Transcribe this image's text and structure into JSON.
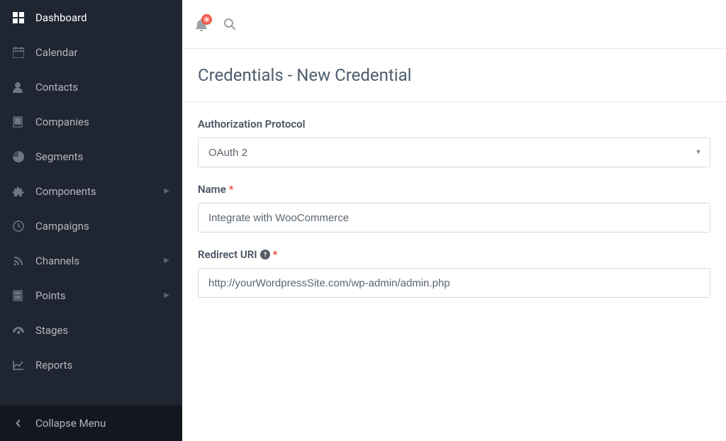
{
  "sidebar": {
    "items": [
      {
        "label": "Dashboard",
        "icon": "grid-icon",
        "caret": false
      },
      {
        "label": "Calendar",
        "icon": "calendar-icon",
        "caret": false
      },
      {
        "label": "Contacts",
        "icon": "user-icon",
        "caret": false
      },
      {
        "label": "Companies",
        "icon": "building-icon",
        "caret": false
      },
      {
        "label": "Segments",
        "icon": "piechart-icon",
        "caret": false
      },
      {
        "label": "Components",
        "icon": "puzzle-icon",
        "caret": true
      },
      {
        "label": "Campaigns",
        "icon": "clock-icon",
        "caret": false
      },
      {
        "label": "Channels",
        "icon": "rss-icon",
        "caret": true
      },
      {
        "label": "Points",
        "icon": "calculator-icon",
        "caret": true
      },
      {
        "label": "Stages",
        "icon": "gauge-icon",
        "caret": false
      },
      {
        "label": "Reports",
        "icon": "linechart-icon",
        "caret": false
      }
    ],
    "collapse_label": "Collapse Menu"
  },
  "topbar": {
    "notifications_icon": "bell-icon",
    "search_icon": "search-icon"
  },
  "page": {
    "title": "Credentials - New Credential"
  },
  "form": {
    "protocol": {
      "label": "Authorization Protocol",
      "value": "OAuth 2"
    },
    "name": {
      "label": "Name",
      "value": "Integrate with WooCommerce"
    },
    "redirect": {
      "label": "Redirect URI",
      "value": "http://yourWordpressSite.com/wp-admin/admin.php"
    }
  }
}
